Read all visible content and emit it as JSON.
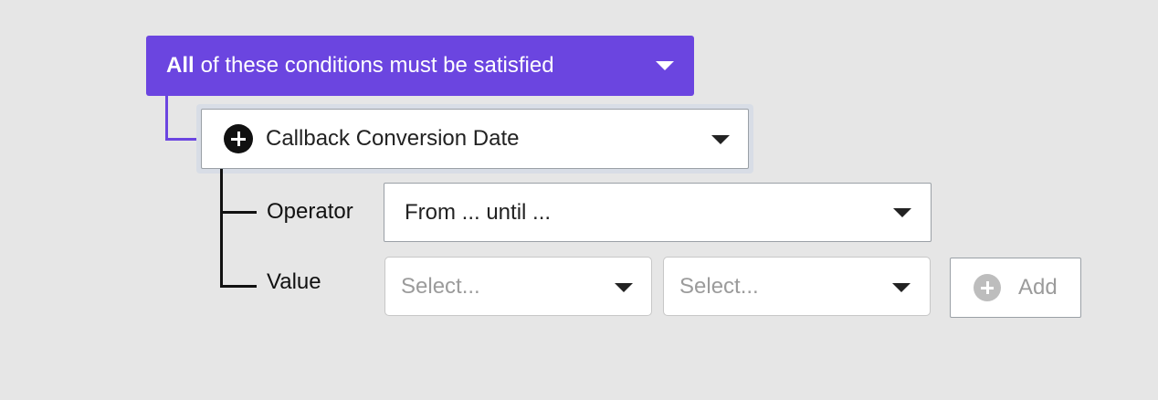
{
  "group": {
    "quantifier": "All",
    "rest": "of these conditions must be satisfied"
  },
  "condition": {
    "field_label": "Callback Conversion Date"
  },
  "operator": {
    "label": "Operator",
    "value": "From ... until ..."
  },
  "value": {
    "label": "Value",
    "from_placeholder": "Select...",
    "until_placeholder": "Select..."
  },
  "add_button": {
    "label": "Add"
  },
  "icons": {
    "group_caret": "chevron-down-icon",
    "field_plus": "plus-circle-icon",
    "add_plus": "plus-circle-icon"
  },
  "colors": {
    "accent": "#6b45e0",
    "background": "#e6e6e6"
  }
}
